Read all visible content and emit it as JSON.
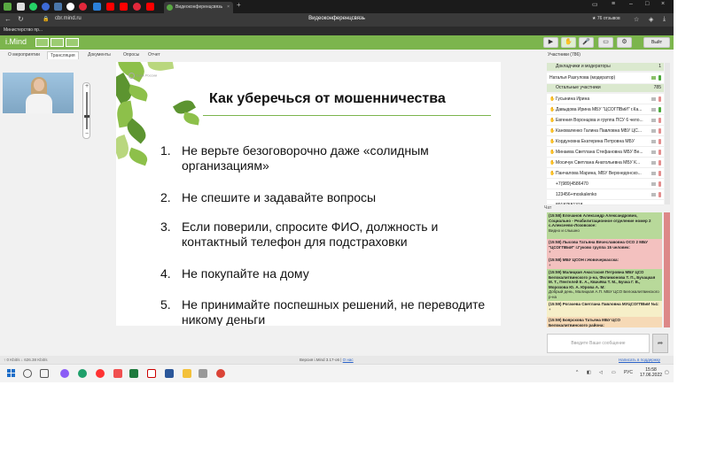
{
  "browser": {
    "active_tab": "Видеоконференцсвязь",
    "url": "cbr.mind.ru",
    "center_title": "Видеоконференцсвязь",
    "reviews": "★ 76 отзывов",
    "bookmark": "Министерство пр..."
  },
  "app": {
    "logo": "i.Mind",
    "exit_label": "Выйт"
  },
  "tabs": [
    "О мероприятии",
    "Трансляция",
    "Документы",
    "Опросы",
    "Отчет"
  ],
  "slide": {
    "brand": "Банк России",
    "title": "Как уберечься от мошенничества",
    "items": [
      {
        "num": "1.",
        "text": "Не верьте безоговорочно даже «солидным организациям»"
      },
      {
        "num": "2.",
        "text": "Не спешите и задавайте вопросы"
      },
      {
        "num": "3.",
        "text": "Если поверили, спросите ФИО, должность и контактный телефон для подстраховки"
      },
      {
        "num": "4.",
        "text": "Не покупайте на дому"
      },
      {
        "num": "5.",
        "text": "Не принимайте поспешных решений, не переводите никому деньги"
      }
    ]
  },
  "participants": {
    "header": "Участники (786)",
    "moderators_label": "Докладчики и модераторы",
    "moderators_count": "1",
    "moderator_name": "Наталья Разгулова (модератор)",
    "others_label": "Остальные участники",
    "others_count": "785",
    "list": [
      "Гусынина Ирина",
      "Давыдова Ирина МБУ \"ЦСОГПВиИ\" г.Ка...",
      "Евгения Воронцова и группа ПСУ 6 чело...",
      "Кановаленко Галина Павловна МБУ ЦС...",
      "Кордуновна Екатерина Петровна МБУ",
      "Минаева Светлана Стефановна МБУ Ве...",
      "Мосичук Светлана Анатольевна МБУ К...",
      "Панчалова Марина, МБУ Верхнедонско...",
      "+7(989)4586470",
      "123456+moskalenko",
      "89187581318"
    ]
  },
  "chat": {
    "label": "Чат",
    "messages": [
      {
        "head": "(15:58) Елочанов Александр Александрович, Социально - Реабилитационное отделение номер 2 с.Алексеево-Лозовское:",
        "body": "Видно и слышно",
        "color": "green"
      },
      {
        "head": "(15:58) Лысова Татьяна Вячеславовна ОСО 2 МБУ \"ЦСОГПВиИ\" г.Гуково группа 15 человек:",
        "body": "+",
        "color": "pink"
      },
      {
        "head": "(15:58) МБУ ЦСОН г.Новочеркасска:",
        "body": "+",
        "color": "pink"
      },
      {
        "head": "(15:59) Малицкая Анастасия Петровна МБУ ЦСО Белокалитвинского р-на, Филимонова Т. П., Бучацкая М. Т., Пентелей Е. А., Квачёва Т. М., Бучка Г. В., Морозова Ю. А. Юрова А. М:",
        "body": "Добрый день, Малицкая А.П. МБУ ЦСО Белокалитвинского р-на",
        "color": "green"
      },
      {
        "head": "(15:59) Рогачева Светлана Павловна МУЦСОГПВиИ №1:",
        "body": "+",
        "color": "yellow"
      },
      {
        "head": "(15:59) Боярскова Татьяна МБУ ЦСО Белокалитвинского района:",
        "body": "",
        "color": "peach"
      }
    ],
    "input_placeholder": "Введите Ваше сообщение"
  },
  "status": {
    "left": "↑ 0 Kbit/s   ↓ 626.38 Kbit/s",
    "version": "Версия i.Mind 3.17-o6",
    "help": "О нас",
    "report": "Написать в поддержку"
  },
  "taskbar": {
    "lang": "РУС",
    "time": "15:58",
    "date": "17.06.2022"
  }
}
